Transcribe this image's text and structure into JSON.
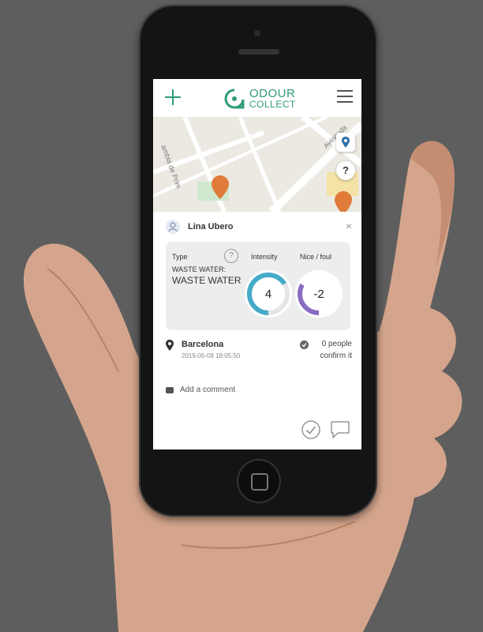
{
  "app": {
    "logo_line1": "ODOUR",
    "logo_line2": "COLLECT"
  },
  "header": {
    "add_icon": "plus-icon",
    "menu_icon": "hamburger-icon"
  },
  "map": {
    "street_label_1": "Avinguda",
    "street_label_2": "ambla de Prim",
    "location_button_icon": "location-pin-icon",
    "help_button_label": "?",
    "marker_color": "#e07b3a"
  },
  "report": {
    "user_name": "Lina Ubero",
    "close_label": "×",
    "type_label": "Type",
    "type_help": "?",
    "type_category": "WASTE WATER:",
    "type_name": "WASTE WATER",
    "intensity_label": "Intensity",
    "intensity_value": "4",
    "intensity_fraction": 0.66,
    "hedonic_label": "Nice / foul",
    "hedonic_value": "-2",
    "hedonic_fraction": 0.33,
    "location_name": "Barcelona",
    "timestamp": "2019-05-08 18:05:50",
    "confirm_line1": "0 people",
    "confirm_line2": "confirm it",
    "comment_placeholder": "Add a comment"
  },
  "colors": {
    "brand": "#2f9c79",
    "intensity_ring": "#45aac8",
    "hedonic_ring": "#8a6cc4",
    "background": "#5e5e5e"
  }
}
